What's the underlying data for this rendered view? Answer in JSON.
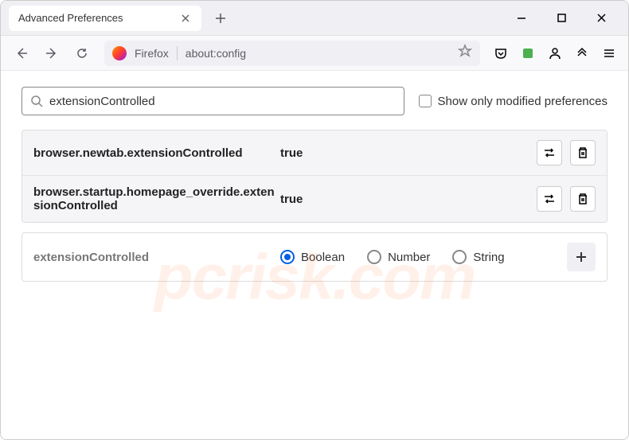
{
  "window": {
    "tab_title": "Advanced Preferences"
  },
  "addressbar": {
    "brand": "Firefox",
    "url": "about:config"
  },
  "search": {
    "value": "extensionControlled",
    "checkbox_label": "Show only modified preferences"
  },
  "prefs": [
    {
      "name": "browser.newtab.extensionControlled",
      "value": "true"
    },
    {
      "name": "browser.startup.homepage_override.extensionControlled",
      "value": "true"
    }
  ],
  "newpref": {
    "name": "extensionControlled",
    "types": [
      "Boolean",
      "Number",
      "String"
    ],
    "selected": 0
  },
  "watermark": "pcrisk.com"
}
